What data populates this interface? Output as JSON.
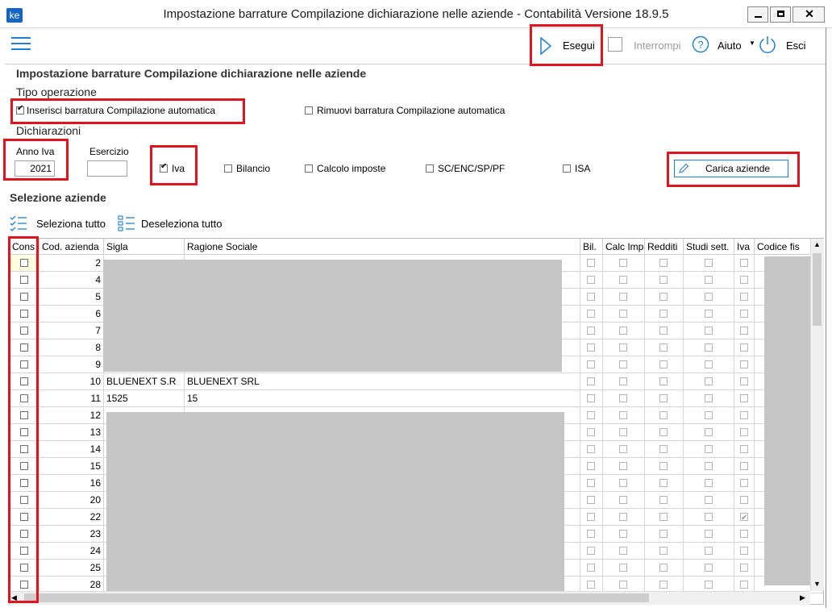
{
  "window": {
    "title": "Impostazione barrature Compilazione dichiarazione nelle aziende - Contabilità Versione 18.9.5",
    "app_icon": "ke"
  },
  "toolbar": {
    "run_label": "Esegui",
    "stop_label": "Interrompi",
    "help_label": "Aiuto",
    "exit_label": "Esci"
  },
  "form": {
    "heading": "Impostazione barrature Compilazione dichiarazione nelle aziende",
    "op_type_label": "Tipo operazione",
    "insert_label": "Inserisci barratura Compilazione automatica",
    "insert_checked": true,
    "remove_label": "Rimuovi barratura Compilazione automatica",
    "remove_checked": false,
    "declarations_label": "Dichiarazioni",
    "anno_iva_label": "Anno Iva",
    "anno_iva_value": "2021",
    "esercizio_label": "Esercizio",
    "esercizio_value": "",
    "iva_label": "Iva",
    "iva_checked": true,
    "bilancio_label": "Bilancio",
    "calcolo_label": "Calcolo imposte",
    "sc_label": "SC/ENC/SP/PF",
    "isa_label": "ISA",
    "load_button": "Carica aziende"
  },
  "selection": {
    "heading": "Selezione aziende",
    "select_all": "Seleziona tutto",
    "deselect_all": "Deseleziona tutto"
  },
  "table": {
    "columns": [
      "Cons",
      "Cod. azienda",
      "Sigla",
      "Ragione Sociale",
      "Bil.",
      "Calc Imp.",
      "Redditi",
      "Studi sett.",
      "Iva",
      "Codice fis"
    ],
    "rows": [
      {
        "code": "2",
        "sigla": "",
        "ragione": "",
        "iva": false
      },
      {
        "code": "4",
        "sigla": "",
        "ragione": "",
        "iva": false
      },
      {
        "code": "5",
        "sigla": "",
        "ragione": "",
        "iva": false
      },
      {
        "code": "6",
        "sigla": "",
        "ragione": "",
        "iva": false
      },
      {
        "code": "7",
        "sigla": "",
        "ragione": "",
        "iva": false
      },
      {
        "code": "8",
        "sigla": "",
        "ragione": "",
        "iva": false
      },
      {
        "code": "9",
        "sigla": "",
        "ragione": "",
        "iva": false
      },
      {
        "code": "10",
        "sigla": "BLUENEXT S.R",
        "ragione": "BLUENEXT SRL",
        "iva": false
      },
      {
        "code": "11",
        "sigla": "1525",
        "ragione": "15",
        "iva": false
      },
      {
        "code": "12",
        "sigla": "",
        "ragione": "",
        "iva": false
      },
      {
        "code": "13",
        "sigla": "",
        "ragione": "",
        "iva": false
      },
      {
        "code": "14",
        "sigla": "",
        "ragione": "",
        "iva": false
      },
      {
        "code": "15",
        "sigla": "",
        "ragione": "",
        "iva": false
      },
      {
        "code": "16",
        "sigla": "",
        "ragione": "",
        "iva": false
      },
      {
        "code": "20",
        "sigla": "",
        "ragione": "",
        "iva": false
      },
      {
        "code": "22",
        "sigla": "",
        "ragione": "",
        "iva": true
      },
      {
        "code": "23",
        "sigla": "",
        "ragione": "",
        "iva": false
      },
      {
        "code": "24",
        "sigla": "",
        "ragione": "",
        "iva": false
      },
      {
        "code": "25",
        "sigla": "",
        "ragione": "",
        "iva": false
      },
      {
        "code": "28",
        "sigla": "",
        "ragione": "",
        "iva": false
      }
    ]
  },
  "colors": {
    "highlight": "#e0141e",
    "accent": "#1f7fd4",
    "redacted": "#c6c6c6"
  }
}
